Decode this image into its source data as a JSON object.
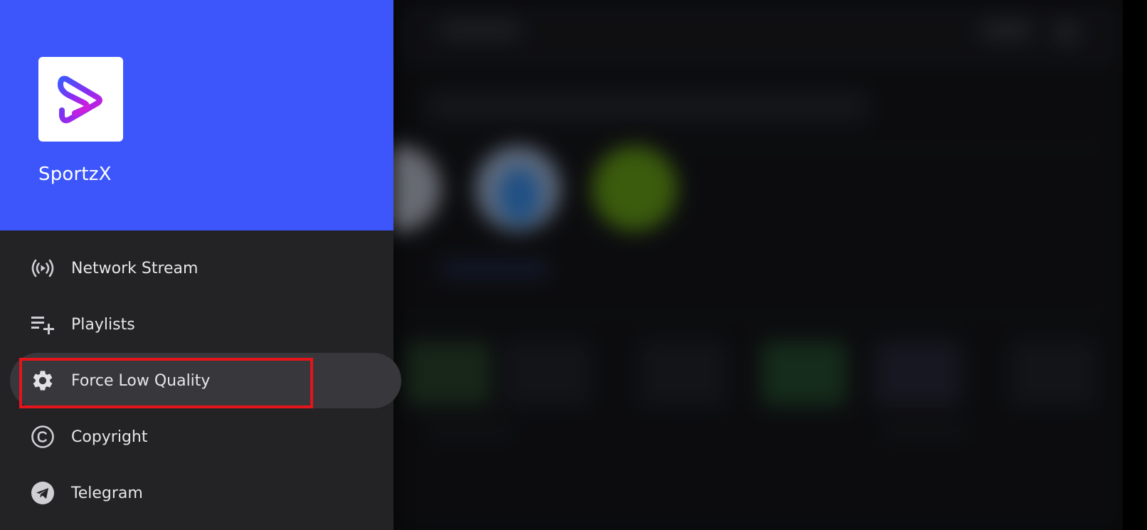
{
  "app": {
    "name": "SportzX",
    "logo_icon": "play-s-logo-icon"
  },
  "drawer": {
    "header_color": "#3c56fc",
    "items": [
      {
        "label": "Network Stream",
        "icon": "broadcast-icon",
        "selected": false
      },
      {
        "label": "Playlists",
        "icon": "playlist-add-icon",
        "selected": false
      },
      {
        "label": "Force Low Quality",
        "icon": "gear-icon",
        "selected": true
      },
      {
        "label": "Copyright",
        "icon": "copyright-icon",
        "selected": false
      },
      {
        "label": "Telegram",
        "icon": "telegram-icon",
        "selected": false
      }
    ]
  },
  "highlight": {
    "color": "#e5141a",
    "target": "Force Low Quality"
  }
}
